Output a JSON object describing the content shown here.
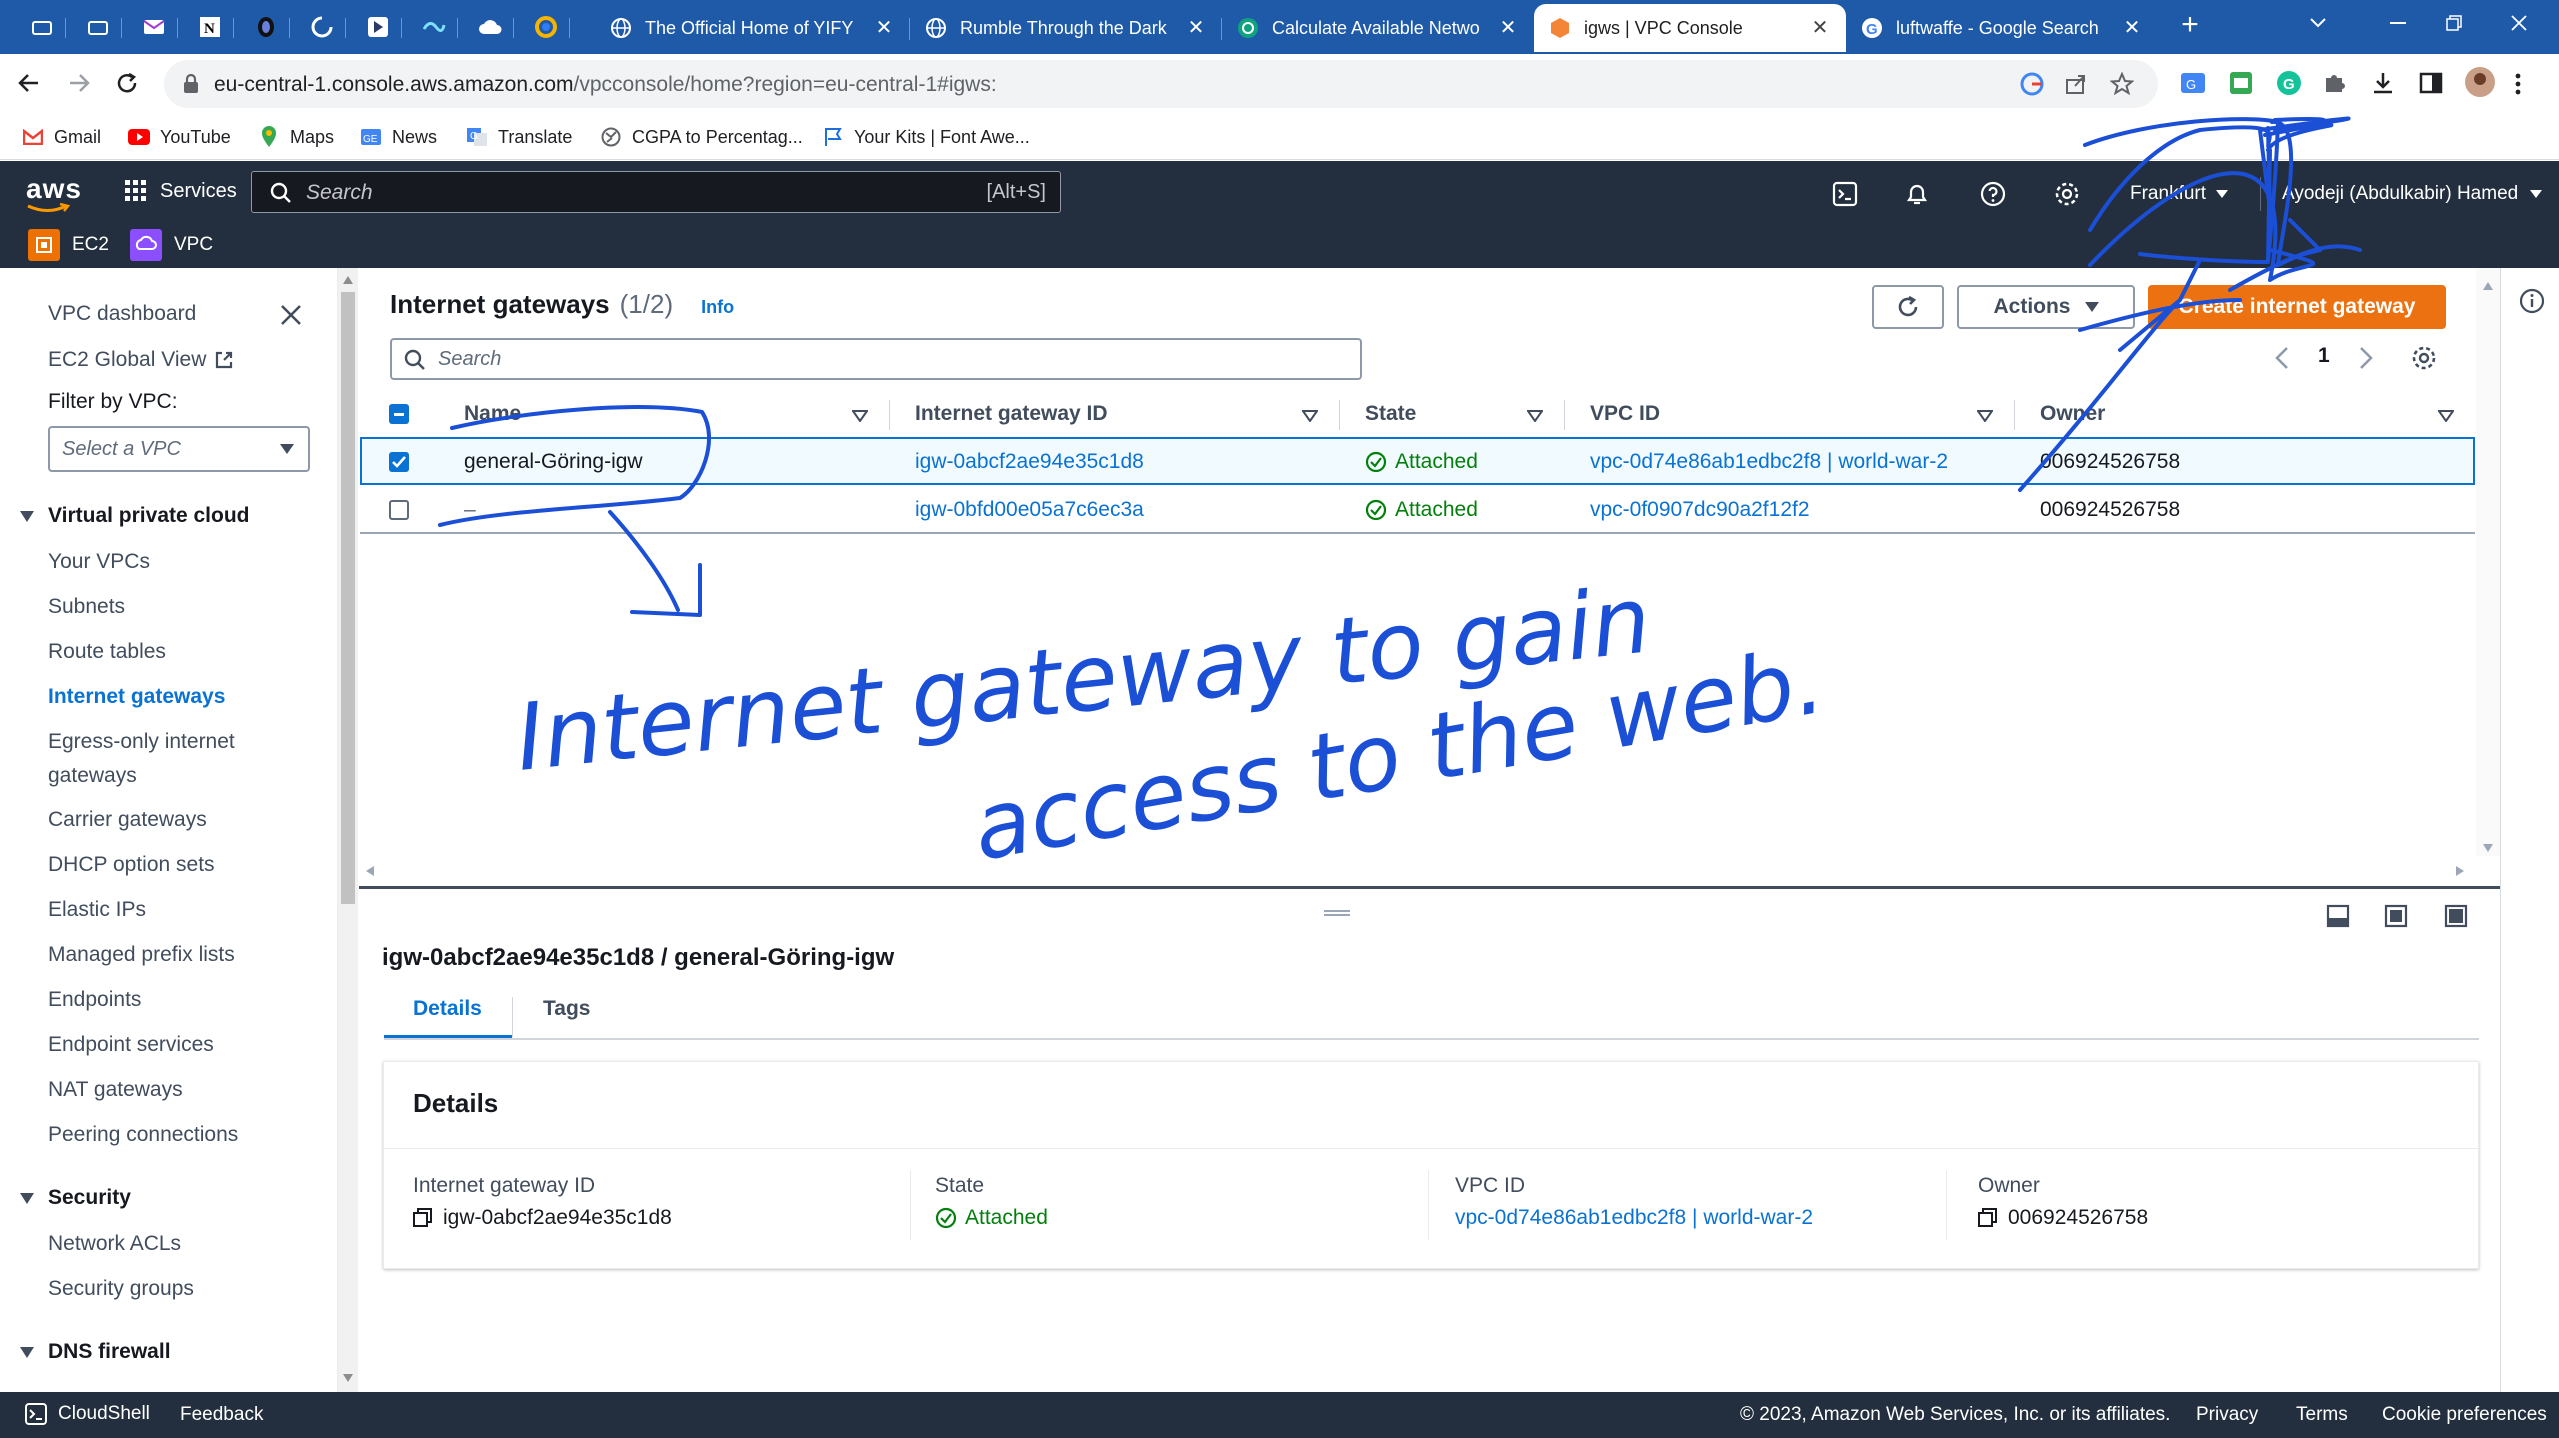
{
  "browser": {
    "tabs": [
      {
        "title": "The Official Home of YIFY"
      },
      {
        "title": "Rumble Through the Dark"
      },
      {
        "title": "Calculate Available Netwo"
      },
      {
        "title": "igws | VPC Console"
      },
      {
        "title": "luftwaffe - Google Search"
      }
    ],
    "new_tab_label": "+",
    "address": {
      "host": "eu-central-1.console.aws.amazon.com",
      "path": "/vpcconsole/home?region=eu-central-1#igws:"
    },
    "bookmarks": [
      {
        "label": "Gmail",
        "icon": "gmail-icon"
      },
      {
        "label": "YouTube",
        "icon": "youtube-icon"
      },
      {
        "label": "Maps",
        "icon": "maps-icon"
      },
      {
        "label": "News",
        "icon": "news-icon"
      },
      {
        "label": "Translate",
        "icon": "translate-icon"
      },
      {
        "label": "CGPA to Percentag...",
        "icon": "globe-icon"
      },
      {
        "label": "Your Kits | Font Awe...",
        "icon": "flag-icon"
      }
    ]
  },
  "aws": {
    "logo": "aws",
    "services_label": "Services",
    "search_placeholder": "Search",
    "search_shortcut": "[Alt+S]",
    "region": "Frankfurt",
    "user": "Ayodeji (Abdulkabir) Hamed",
    "favorites": [
      {
        "label": "EC2"
      },
      {
        "label": "VPC"
      }
    ]
  },
  "sidebar": {
    "dashboard": "VPC dashboard",
    "global_view": "EC2 Global View",
    "filter_label": "Filter by VPC:",
    "filter_placeholder": "Select a VPC",
    "section_vpc": "Virtual private cloud",
    "vpc_items": [
      "Your VPCs",
      "Subnets",
      "Route tables",
      "Internet gateways",
      "Egress-only internet",
      "gateways",
      "Carrier gateways",
      "DHCP option sets",
      "Elastic IPs",
      "Managed prefix lists",
      "Endpoints",
      "Endpoint services",
      "NAT gateways",
      "Peering connections"
    ],
    "section_security": "Security",
    "security_items": [
      "Network ACLs",
      "Security groups"
    ],
    "section_dns": "DNS firewall"
  },
  "table": {
    "title": "Internet gateways",
    "count": "(1/2)",
    "info": "Info",
    "actions": "Actions",
    "create": "Create internet gateway",
    "search_placeholder": "Search",
    "page": "1",
    "columns": [
      "Name",
      "Internet gateway ID",
      "State",
      "VPC ID",
      "Owner"
    ],
    "rows": [
      {
        "name": "general-Göring-igw",
        "id": "igw-0abcf2ae94e35c1d8",
        "state": "Attached",
        "vpc": "vpc-0d74e86ab1edbc2f8 | world-war-2",
        "owner": "006924526758",
        "selected": true
      },
      {
        "name": "–",
        "id": "igw-0bfd00e05a7c6ec3a",
        "state": "Attached",
        "vpc": "vpc-0f0907dc90a2f12f2",
        "owner": "006924526758",
        "selected": false
      }
    ]
  },
  "detail": {
    "heading": "igw-0abcf2ae94e35c1d8 / general-Göring-igw",
    "tabs": [
      "Details",
      "Tags"
    ],
    "panel_title": "Details",
    "fields": [
      {
        "label": "Internet gateway ID",
        "value": "igw-0abcf2ae94e35c1d8"
      },
      {
        "label": "State",
        "value": "Attached"
      },
      {
        "label": "VPC ID",
        "value": "vpc-0d74e86ab1edbc2f8 | world-war-2"
      },
      {
        "label": "Owner",
        "value": "006924526758"
      }
    ]
  },
  "annotation": {
    "handwriting_line1": "Internet gateway to gain",
    "handwriting_line2": "access to the web.",
    "ink_color": "#1a4fd6"
  },
  "footer": {
    "cloudshell": "CloudShell",
    "feedback": "Feedback",
    "copyright": "© 2023, Amazon Web Services, Inc. or its affiliates.",
    "privacy": "Privacy",
    "terms": "Terms",
    "cookies": "Cookie preferences"
  }
}
